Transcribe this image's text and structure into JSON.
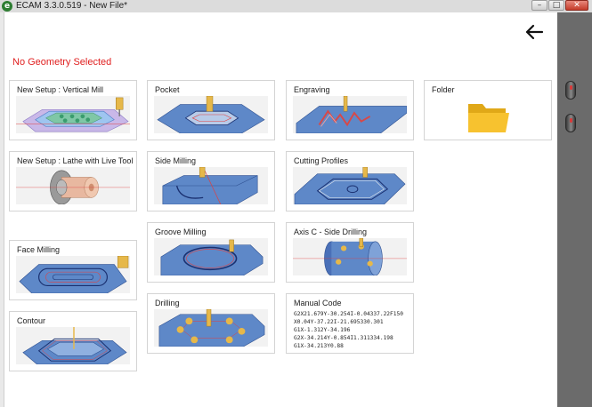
{
  "window": {
    "icon_letter": "e",
    "title": "ECAM 3.3.0.519 - New File*",
    "minimize_glyph": "–",
    "maximize_glyph": "□",
    "close_glyph": "✕"
  },
  "status_text": "No Geometry Selected",
  "cards": {
    "setup_mill": "New Setup : Vertical Mill",
    "setup_lathe": "New Setup : Lathe with Live Tool",
    "face_milling": "Face Milling",
    "contour": "Contour",
    "pocket": "Pocket",
    "side_milling": "Side Milling",
    "groove_milling": "Groove Milling",
    "drilling": "Drilling",
    "engraving": "Engraving",
    "cutting_profiles": "Cutting Profiles",
    "axis_c": "Axis C - Side Drilling",
    "manual_code": "Manual Code",
    "folder": "Folder"
  },
  "manual_code_lines": [
    "G2X21.679Y-30.254I-0.04337.22F150",
    "X0.04Y-37.22I-21.695330.301",
    "G1X-1.312Y-34.196",
    "G2X-34.214Y-0.854I1.311334.198",
    "G1X-34.213Y0.88"
  ],
  "icons": {
    "back": "arrow-left-icon",
    "mouse_top": "mouse-icon",
    "mouse_bottom": "mouse-icon"
  },
  "colors": {
    "accent_red": "#e02020",
    "part_blue": "#5e88c8",
    "part_dark_blue": "#3b5fa8",
    "tool_gold": "#e6b84a",
    "folder_yellow": "#f7c22f",
    "right_panel": "#6b6b6b"
  }
}
